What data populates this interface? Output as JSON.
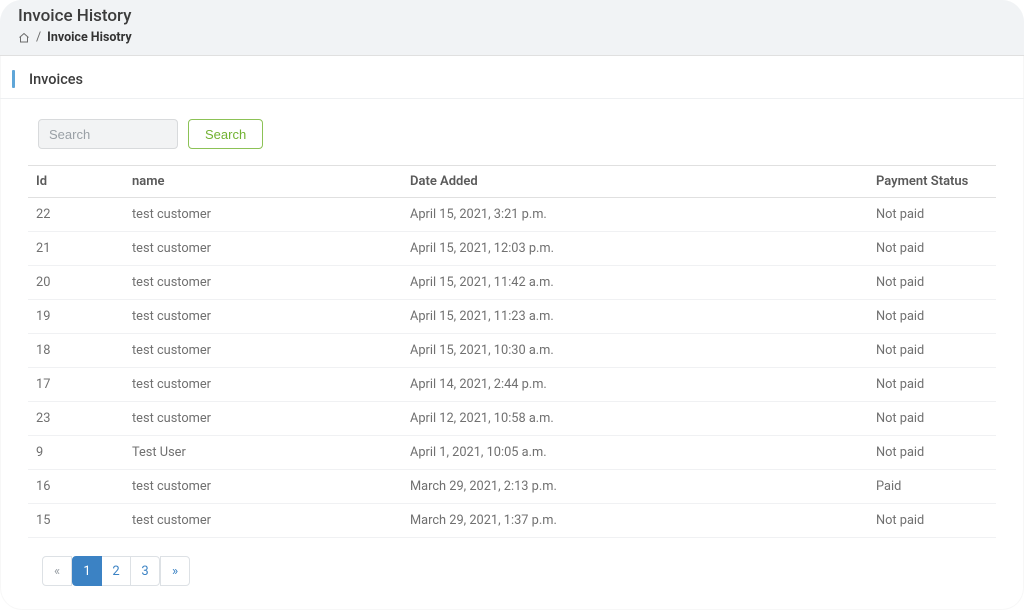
{
  "header": {
    "title": "Invoice History",
    "breadcrumb_current": "Invoice Hisotry"
  },
  "section": {
    "title": "Invoices"
  },
  "search": {
    "placeholder": "Search",
    "button": "Search"
  },
  "table": {
    "headers": {
      "id": "Id",
      "name": "name",
      "date_added": "Date Added",
      "payment_status": "Payment Status"
    },
    "rows": [
      {
        "id": "22",
        "name": "test customer",
        "date": "April 15, 2021, 3:21 p.m.",
        "status": "Not paid"
      },
      {
        "id": "21",
        "name": "test customer",
        "date": "April 15, 2021, 12:03 p.m.",
        "status": "Not paid"
      },
      {
        "id": "20",
        "name": "test customer",
        "date": "April 15, 2021, 11:42 a.m.",
        "status": "Not paid"
      },
      {
        "id": "19",
        "name": "test customer",
        "date": "April 15, 2021, 11:23 a.m.",
        "status": "Not paid"
      },
      {
        "id": "18",
        "name": "test customer",
        "date": "April 15, 2021, 10:30 a.m.",
        "status": "Not paid"
      },
      {
        "id": "17",
        "name": "test customer",
        "date": "April 14, 2021, 2:44 p.m.",
        "status": "Not paid"
      },
      {
        "id": "23",
        "name": "test customer",
        "date": "April 12, 2021, 10:58 a.m.",
        "status": "Not paid"
      },
      {
        "id": "9",
        "name": "Test User",
        "date": "April 1, 2021, 10:05 a.m.",
        "status": "Not paid"
      },
      {
        "id": "16",
        "name": "test customer",
        "date": "March 29, 2021, 2:13 p.m.",
        "status": "Paid"
      },
      {
        "id": "15",
        "name": "test customer",
        "date": "March 29, 2021, 1:37 p.m.",
        "status": "Not paid"
      }
    ]
  },
  "pagination": {
    "prev": "«",
    "next": "»",
    "pages": [
      "1",
      "2",
      "3"
    ],
    "active": "1"
  }
}
